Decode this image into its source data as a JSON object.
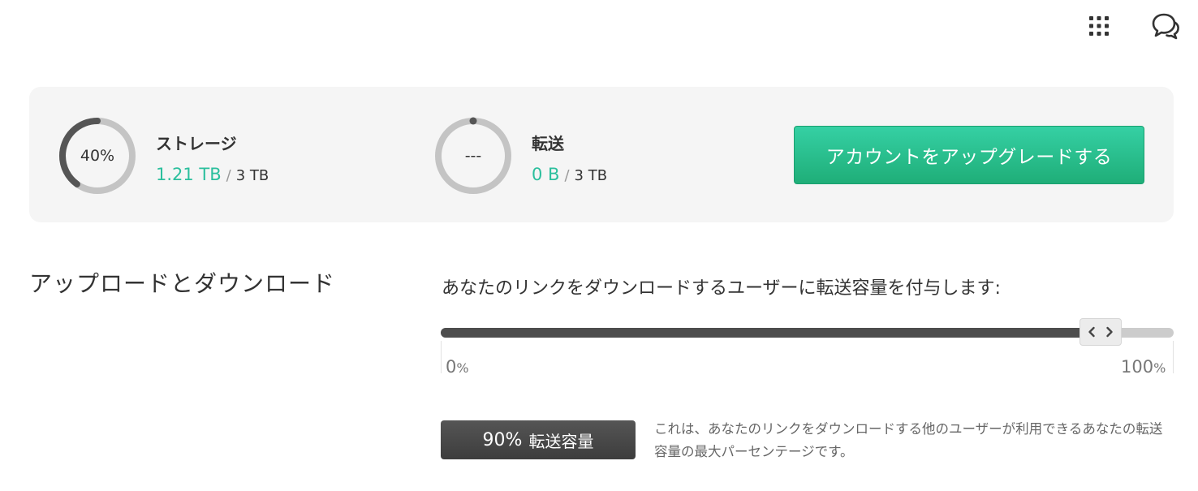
{
  "header": {
    "icons": [
      "apps-grid-icon",
      "chat-bubbles-icon"
    ]
  },
  "usage": {
    "storage": {
      "percent_label": "40%",
      "fraction": 0.4,
      "title": "ストレージ",
      "used": "1.21 TB",
      "separator": "/",
      "total": "3 TB"
    },
    "transfer": {
      "percent_label": "---",
      "fraction": 0.0,
      "title": "転送",
      "used": "0 B",
      "separator": "/",
      "total": "3 TB"
    },
    "upgrade_button": "アカウントをアップグレードする"
  },
  "section": {
    "title": "アップロードとダウンロード",
    "prompt": "あなたのリンクをダウンロードするユーザーに転送容量を付与します:",
    "slider": {
      "value_percent": 90,
      "min_value": "0",
      "min_unit": "%",
      "max_value": "100",
      "max_unit": "%"
    },
    "badge": {
      "value": "90%",
      "label": "転送容量"
    },
    "help": "これは、あなたのリンクをダウンロードする他のユーザーが利用できるあなたの転送容量の最大パーセンテージです。"
  },
  "colors": {
    "accent_green": "#2bbf9d",
    "button_green": "#1fae78",
    "ring_track": "#c4c4c4",
    "ring_fill": "#555555",
    "panel_bg": "#f5f5f5"
  }
}
